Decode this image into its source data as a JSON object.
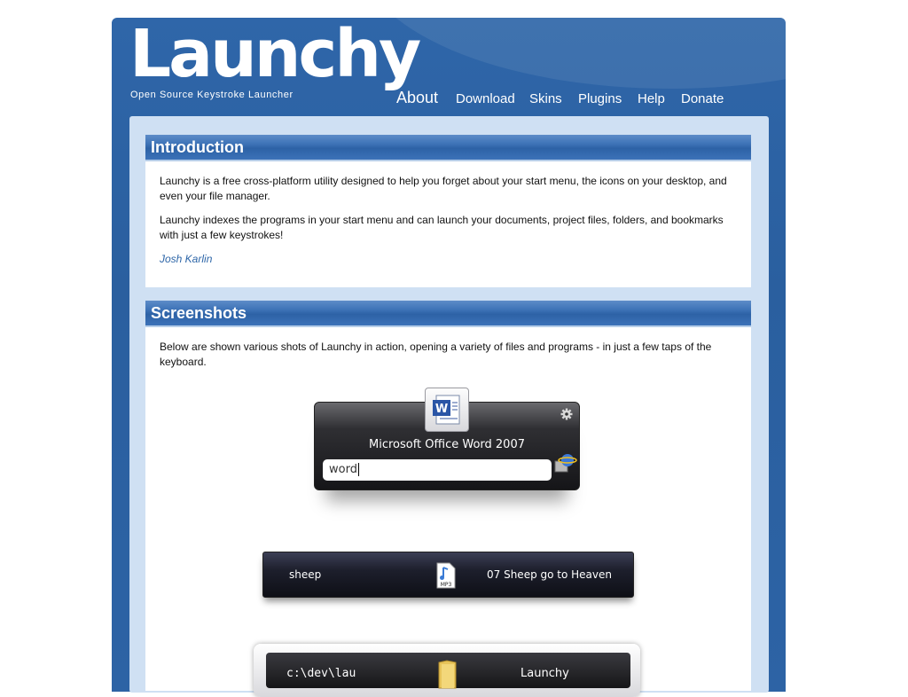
{
  "site": {
    "logo": "Launchy",
    "tagline": "Open Source Keystroke Launcher"
  },
  "nav": [
    {
      "label": "About",
      "active": true
    },
    {
      "label": "Download"
    },
    {
      "label": "Skins"
    },
    {
      "label": "Plugins"
    },
    {
      "label": "Help"
    },
    {
      "label": "Donate"
    }
  ],
  "intro": {
    "title": "Introduction",
    "p1": "Launchy is a free cross-platform utility designed to help you forget about your start menu, the icons on your desktop, and even your file manager.",
    "p2": "Launchy indexes the programs in your start menu and can launch your documents, project files, folders, and bookmarks with just a few keystrokes!",
    "author": "Josh Karlin"
  },
  "screenshots": {
    "title": "Screenshots",
    "text": "Below are shown various shots of Launchy in action, opening a variety of files and programs - in just a few taps of the keyboard.",
    "shot1": {
      "result": "Microsoft Office Word 2007",
      "input": "word",
      "icon": "word-document-icon"
    },
    "shot2": {
      "input": "sheep",
      "result": "07 Sheep go to Heaven",
      "icon": "mp3-file-icon"
    },
    "shot3": {
      "input": "c:\\dev\\lau",
      "result": "Launchy",
      "icon": "folder-icon"
    }
  },
  "colors": {
    "frame_blue": "#2f66a9",
    "panel_light": "#cfe0f3",
    "header_blue": "#3f74b8",
    "link_blue": "#2e66a8"
  }
}
